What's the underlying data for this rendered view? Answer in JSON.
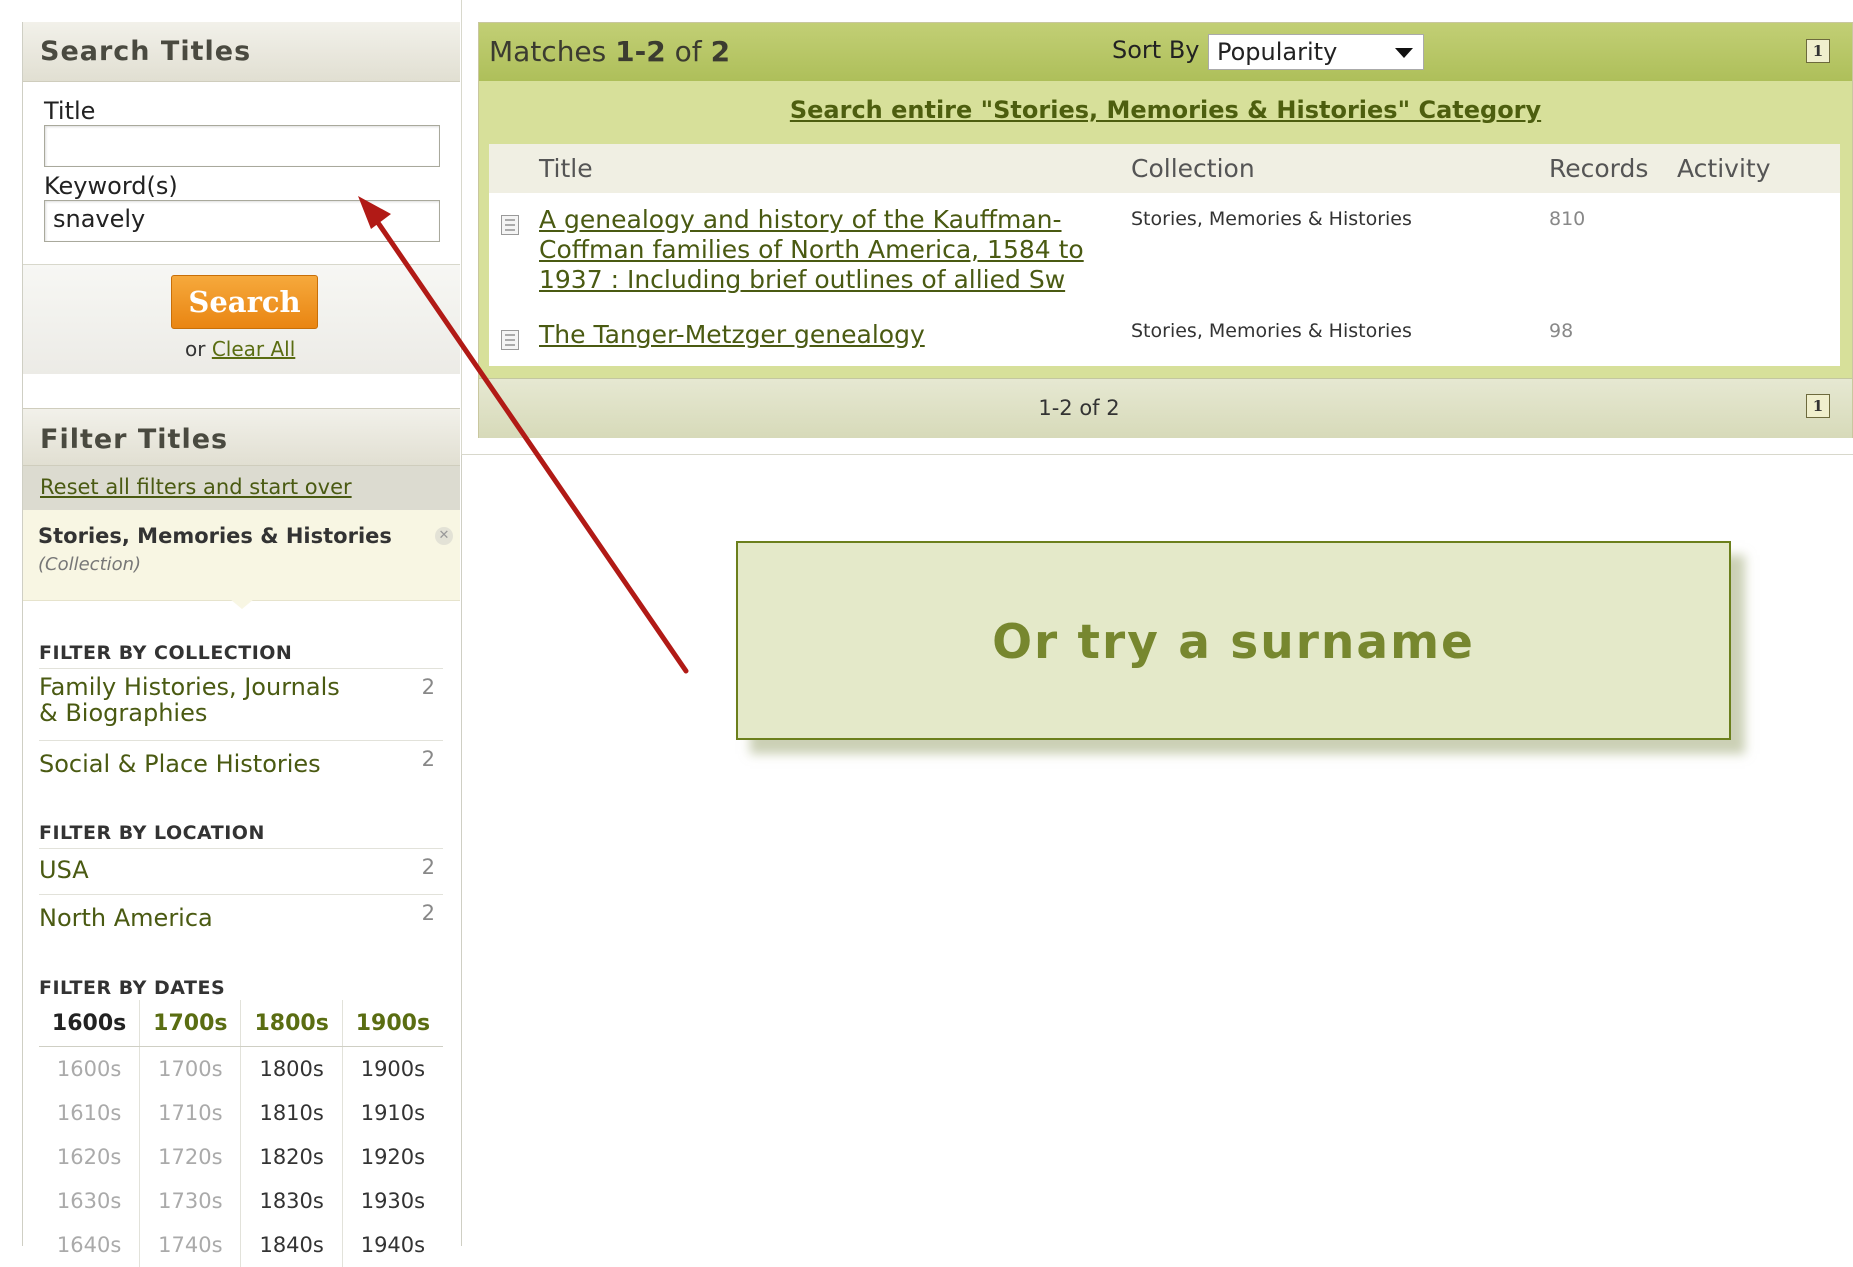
{
  "search_panel": {
    "header": "Search Titles",
    "title_label": "Title",
    "title_value": "",
    "keyword_label": "Keyword(s)",
    "keyword_value": "snavely",
    "search_button": "Search",
    "or_text": "or",
    "clear_all": "Clear All"
  },
  "filter_panel": {
    "header": "Filter Titles",
    "reset_link": "Reset all filters and start over",
    "active_filter": {
      "name": "Stories, Memories & Histories",
      "type": "(Collection)"
    },
    "collection": {
      "title": "FILTER BY COLLECTION",
      "items": [
        {
          "label": "Family Histories, Journals & Biographies",
          "count": "2"
        },
        {
          "label": "Social & Place Histories",
          "count": "2"
        }
      ]
    },
    "location": {
      "title": "FILTER BY LOCATION",
      "items": [
        {
          "label": "USA",
          "count": "2"
        },
        {
          "label": "North America",
          "count": "2"
        }
      ]
    },
    "dates": {
      "title": "FILTER BY DATES",
      "centuries": [
        "1600s",
        "1700s",
        "1800s",
        "1900s"
      ],
      "rows": [
        [
          "1600s",
          "1700s",
          "1800s",
          "1900s"
        ],
        [
          "1610s",
          "1710s",
          "1810s",
          "1910s"
        ],
        [
          "1620s",
          "1720s",
          "1820s",
          "1920s"
        ],
        [
          "1630s",
          "1730s",
          "1830s",
          "1930s"
        ],
        [
          "1640s",
          "1740s",
          "1840s",
          "1940s"
        ]
      ]
    }
  },
  "results": {
    "matches_prefix": "Matches",
    "matches_range": "1-2",
    "matches_of": "of",
    "matches_total": "2",
    "sort_label": "Sort By",
    "sort_value": "Popularity",
    "page": "1",
    "category_link": "Search entire \"Stories, Memories & Histories\" Category",
    "columns": {
      "title": "Title",
      "collection": "Collection",
      "records": "Records",
      "activity": "Activity"
    },
    "rows": [
      {
        "title_lines": [
          "A genealogy and history of the Kauffman-",
          "Coffman families of North America, 1584 to",
          "1937 : Including brief outlines of allied Sw"
        ],
        "collection": "Stories, Memories & Histories",
        "records": "810"
      },
      {
        "title_lines": [
          "The Tanger-Metzger genealogy"
        ],
        "collection": "Stories, Memories & Histories",
        "records": "98"
      }
    ],
    "footer_range": "1-2 of 2"
  },
  "callout": {
    "text": "Or try a surname"
  }
}
